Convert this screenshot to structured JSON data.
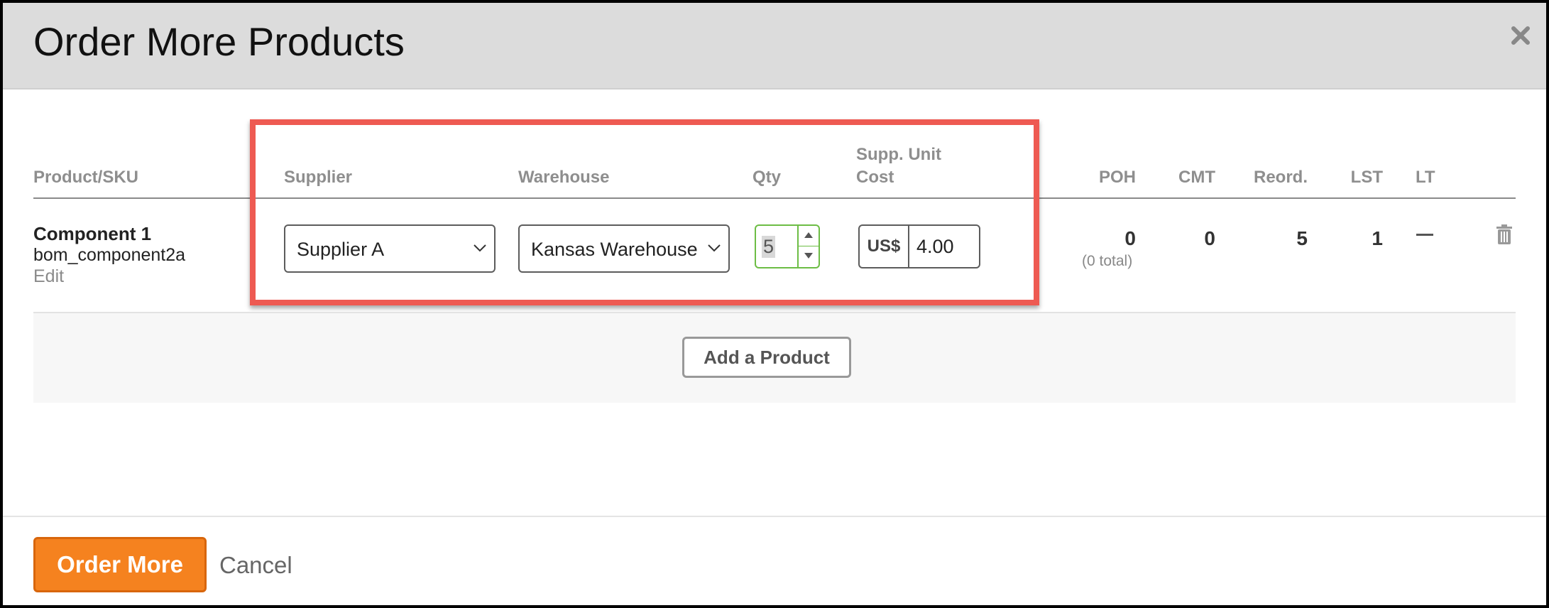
{
  "dialog": {
    "title": "Order More Products",
    "close_icon": "close-icon"
  },
  "columns": {
    "product_sku": "Product/SKU",
    "supplier": "Supplier",
    "warehouse": "Warehouse",
    "qty": "Qty",
    "supp_unit_cost_line1": "Supp. Unit",
    "supp_unit_cost_line2": "Cost",
    "poh": "POH",
    "cmt": "CMT",
    "reord": "Reord.",
    "lst": "LST",
    "lt": "LT"
  },
  "row": {
    "product_name": "Component 1",
    "sku": "bom_component2a",
    "edit_label": "Edit",
    "supplier": "Supplier A",
    "warehouse": "Kansas Warehouse",
    "qty": "5",
    "currency": "US$",
    "unit_cost": "4.00",
    "poh": "0",
    "poh_total": "(0 total)",
    "cmt": "0",
    "reord": "5",
    "lst": "1",
    "lt": "—",
    "delete_icon": "trash-icon"
  },
  "add_product_label": "Add a Product",
  "footer": {
    "order_more_label": "Order More",
    "cancel_label": "Cancel"
  },
  "colors": {
    "accent_orange": "#f5821f",
    "highlight_red": "#ee5a52",
    "qty_focus_green": "#6dbd45",
    "header_bg": "#dcdcdc"
  }
}
